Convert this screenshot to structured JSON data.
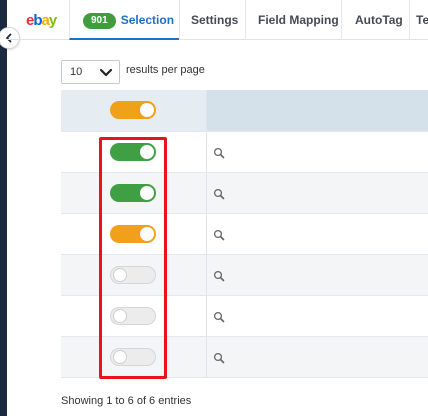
{
  "brand": {
    "logo_letters": [
      "e",
      "b",
      "a",
      "y"
    ]
  },
  "tabs": [
    {
      "label": "Selection",
      "badge": "901",
      "active": true
    },
    {
      "label": "Settings",
      "active": false
    },
    {
      "label": "Field Mapping",
      "active": false
    },
    {
      "label": "AutoTag",
      "active": false
    },
    {
      "label": "Te",
      "active": false
    }
  ],
  "page_length": {
    "value": "10",
    "suffix": "results per page"
  },
  "table": {
    "header_toggle_state": "partial",
    "rows": [
      {
        "toggle_state": "on",
        "search_icon": "magnifier-icon"
      },
      {
        "toggle_state": "on",
        "search_icon": "magnifier-icon"
      },
      {
        "toggle_state": "partial",
        "search_icon": "magnifier-icon"
      },
      {
        "toggle_state": "off",
        "search_icon": "magnifier-icon"
      },
      {
        "toggle_state": "off",
        "search_icon": "magnifier-icon"
      },
      {
        "toggle_state": "off",
        "search_icon": "magnifier-icon"
      }
    ]
  },
  "footer": {
    "info": "Showing 1 to 6 of 6 entries"
  },
  "colors": {
    "toggle_on": "#3fa043",
    "toggle_partial": "#f0a019",
    "accent": "#1f6fc4",
    "highlight": "#e8131b"
  }
}
